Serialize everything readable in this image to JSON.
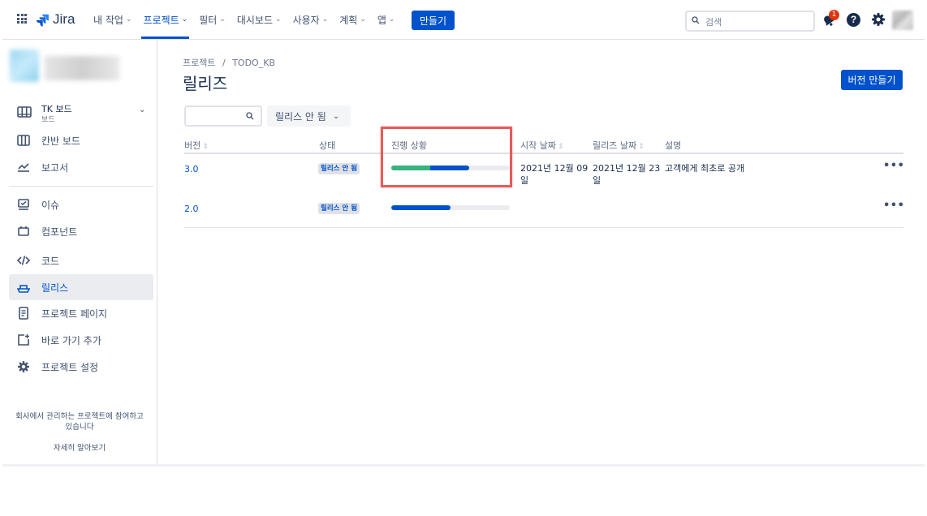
{
  "app": {
    "name": "Jira"
  },
  "topnav": {
    "menu": [
      {
        "label": "내 작업",
        "active": false
      },
      {
        "label": "프로젝트",
        "active": true
      },
      {
        "label": "필터",
        "active": false
      },
      {
        "label": "대시보드",
        "active": false
      },
      {
        "label": "사용자",
        "active": false
      },
      {
        "label": "계획",
        "active": false
      },
      {
        "label": "앱",
        "active": false
      }
    ],
    "create_label": "만들기",
    "search_placeholder": "검색",
    "notification_count": "1",
    "help_glyph": "?"
  },
  "sidebar": {
    "board": {
      "name": "TK 보드",
      "sub": "보드"
    },
    "items": [
      {
        "label": "칸반 보드",
        "icon": "kanban-board-icon"
      },
      {
        "label": "보고서",
        "icon": "reports-icon"
      },
      {
        "label": "이슈",
        "icon": "issues-icon"
      },
      {
        "label": "컴포넌트",
        "icon": "components-icon"
      },
      {
        "label": "코드",
        "icon": "code-icon"
      },
      {
        "label": "릴리스",
        "icon": "releases-icon",
        "selected": true
      },
      {
        "label": "프로젝트 페이지",
        "icon": "project-pages-icon"
      },
      {
        "label": "바로 가기 추가",
        "icon": "add-shortcut-icon"
      },
      {
        "label": "프로젝트 설정",
        "icon": "project-settings-icon"
      }
    ],
    "footer": {
      "line1": "회사에서 관리하는 프로젝트에 참여하고",
      "line2": "있습니다",
      "learn_more": "자세히 알아보기"
    }
  },
  "main": {
    "breadcrumb": {
      "root": "프로젝트",
      "separator": "/",
      "project": "TODO_KB"
    },
    "title": "릴리즈",
    "create_version_label": "버전 만들기",
    "search_value": "",
    "status_filter": "릴리스 안 됨",
    "table": {
      "headers": {
        "version": "버전",
        "status": "상태",
        "progress": "진행 상황",
        "start_date": "시작 날짜",
        "release_date": "릴리즈 날짜",
        "description": "설명"
      },
      "rows": [
        {
          "version": "3.0",
          "status": "릴리스 안 됨",
          "progress": {
            "done": 0.33,
            "in_progress": 0.33
          },
          "start_date": "2021년 12월 09일",
          "release_date": "2021년 12월 23일",
          "description": "고객에게 최초로 공개"
        },
        {
          "version": "2.0",
          "status": "릴리스 안 됨",
          "progress": {
            "done": 0.0,
            "in_progress": 0.5
          },
          "start_date": "",
          "release_date": "",
          "description": ""
        }
      ]
    }
  },
  "colors": {
    "primary": "#0052cc",
    "progress_done": "#36b37e",
    "progress_in_progress": "#0052cc",
    "progress_track": "#ebecf0",
    "highlight": "#e55b5b",
    "badge": "#de350b"
  }
}
